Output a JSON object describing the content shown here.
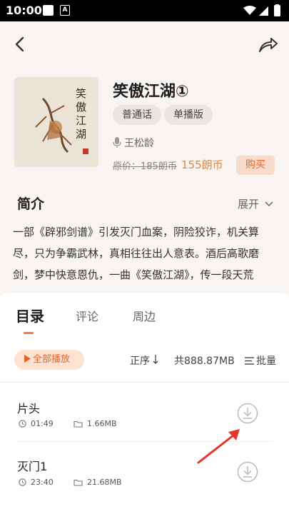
{
  "status_bar": {
    "time": "10:00",
    "app_badge": "A"
  },
  "book": {
    "title": "笑傲江湖①",
    "tags": [
      "普通话",
      "单播版"
    ],
    "author": "王松龄",
    "original_price": "原价：185朗币",
    "price": "155朗币",
    "buy_label": "购买",
    "cover_text": "笑傲江湖"
  },
  "intro": {
    "heading": "简介",
    "expand_label": "展开",
    "text": "一部《辟邪剑谱》引发灭门血案，阴险狡诈，机关算尽，只为争霸武林，真相往往出人意表。酒后高歌磨剑，梦中快意恩仇，一曲《笑傲江湖》，传一段天荒"
  },
  "tabs": [
    "目录",
    "评论",
    "周边"
  ],
  "toolbar": {
    "play_all": "全部播放",
    "sort": "正序",
    "total": "共888.87MB",
    "batch": "批量"
  },
  "tracks": [
    {
      "title": "片头",
      "duration": "01:49",
      "size": "1.66MB"
    },
    {
      "title": "灭门1",
      "duration": "23:40",
      "size": "21.68MB"
    }
  ],
  "colors": {
    "accent": "#ef7d3a",
    "price": "#e8863c",
    "background": "#f7f4f1"
  }
}
